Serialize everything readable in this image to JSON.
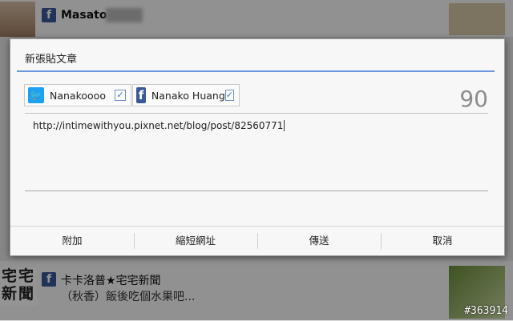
{
  "background": {
    "top_user_name": "Masato",
    "bottom_feed": {
      "name": "卡卡洛普★宅宅新聞",
      "text": "（秋香）飯後吃個水果吧...",
      "avatar_text": "宅宅\n新聞"
    },
    "watermark": "#363914"
  },
  "dialog": {
    "title": "新張貼文章",
    "accounts": [
      {
        "service": "twitter",
        "icon": "twitter-icon",
        "name": "Nanakoooo",
        "checked": true
      },
      {
        "service": "facebook",
        "icon": "facebook-icon",
        "name": "Nanako Huang",
        "checked": true
      }
    ],
    "char_count": "90",
    "post_text": "http://intimewithyou.pixnet.net/blog/post/82560771",
    "buttons": {
      "attach": "附加",
      "shorten": "縮短網址",
      "send": "傳送",
      "cancel": "取消"
    }
  },
  "colors": {
    "accent_rule": "#6a97e0",
    "facebook": "#3b5998",
    "twitter": "#1da1f2"
  }
}
